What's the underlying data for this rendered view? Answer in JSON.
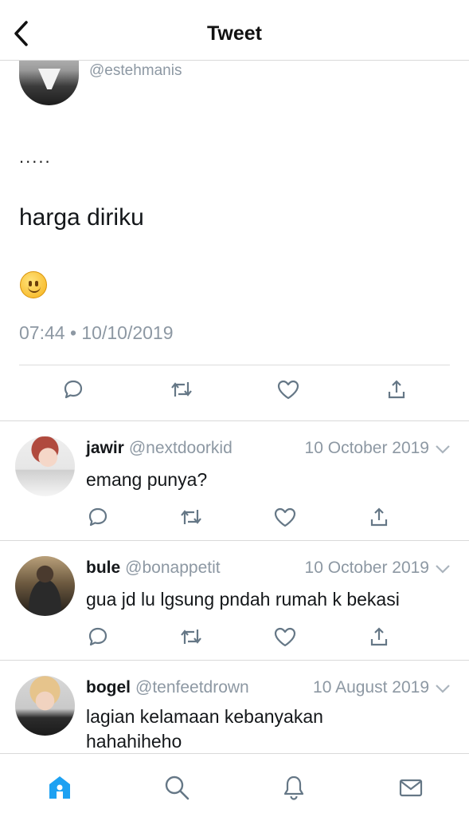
{
  "header": {
    "title": "Tweet"
  },
  "main_tweet": {
    "handle": "@estehmanis",
    "dots": ".....",
    "text": "harga diriku",
    "emoji": "slightly-smiling-face",
    "timestamp": "07:44 • 10/10/2019"
  },
  "actions": [
    "reply-icon",
    "retweet-icon",
    "like-icon",
    "share-icon"
  ],
  "replies": [
    {
      "name": "jawir",
      "handle": "@nextdoorkid",
      "date": "10 October 2019",
      "text": "emang punya?"
    },
    {
      "name": "bule",
      "handle": "@bonappetit",
      "date": "10 October 2019",
      "text": "gua jd lu lgsung pndah rumah k bekasi"
    },
    {
      "name": "bogel",
      "handle": "@tenfeetdrown",
      "date": "10 August 2019",
      "text": "lagian kelamaan kebanyakan hahahiheho"
    }
  ],
  "tabbar": {
    "items": [
      "home-icon",
      "search-icon",
      "notifications-icon",
      "messages-icon"
    ],
    "active_color": "#1da1f2",
    "inactive_color": "#657786"
  },
  "colors": {
    "secondary_text": "#8d98a3",
    "icon_gray": "#657786",
    "accent": "#1da1f2"
  }
}
